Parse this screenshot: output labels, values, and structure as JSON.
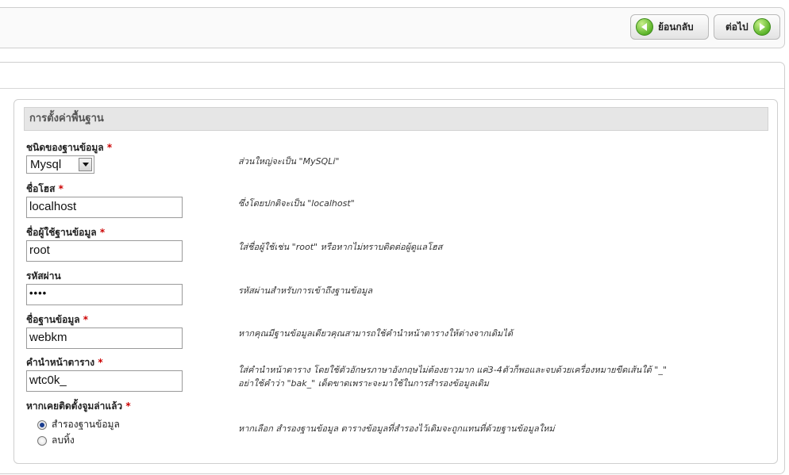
{
  "toolbar": {
    "back_label": "ย้อนกลับ",
    "next_label": "ต่อไป"
  },
  "section": {
    "title": "การตั้งค่าพื้นฐาน"
  },
  "required_mark": "*",
  "fields": {
    "db_type": {
      "label": "ชนิดของฐานข้อมูล",
      "value": "Mysql",
      "hint": "ส่วนใหญ่จะเป็น \"MySQLi\""
    },
    "host": {
      "label": "ชื่อโฮส",
      "value": "localhost",
      "hint": "ซึ่งโดยปกติจะเป็น \"localhost\""
    },
    "db_user": {
      "label": "ชื่อผู้ใช้ฐานข้อมูล",
      "value": "root",
      "hint": "ใส่ชื่อผู้ใช้เช่น \"root\" หรือหากไม่ทราบติดต่อผู้ดูแลโฮส"
    },
    "password": {
      "label": "รหัสผ่าน",
      "value": "••••",
      "hint": "รหัสผ่านสำหรับการเข้าถึงฐานข้อมูล"
    },
    "db_name": {
      "label": "ชื่อฐานข้อมูล",
      "value": "webkm",
      "hint": "หากคุณมีฐานข้อมูลเดียวคุณสามารถใช้คำนำหน้าตารางให้ต่างจากเดิมได้"
    },
    "prefix": {
      "label": "คำนำหน้าตาราง",
      "value": "wtc0k_",
      "hint_line1": "ใส่คำนำหน้าตาราง โดยใช้ตัวอักษรภาษาอังกฤษไม่ต้องยาวมาก แค่3-4ตัวก็พอและจบด้วยเครื่องหมายขีดเส้นใต้ \"_\"",
      "hint_line2": "อย่าใช้คำว่า \"bak_\" เด็ดขาดเพราะจะมาใช้ในการสำรองข้อมูลเดิม"
    },
    "existing": {
      "label": "หากเคยติดตั้งจูมล่าแล้ว",
      "option_backup": "สำรองฐานข้อมูล",
      "option_delete": "ลบทิ้ง",
      "hint": "หากเลือก สำรองฐานข้อมูล ตารางข้อมูลที่สำรองไว้เดิมจะถูกแทนที่ด้วยฐานข้อมูลใหม่"
    }
  }
}
